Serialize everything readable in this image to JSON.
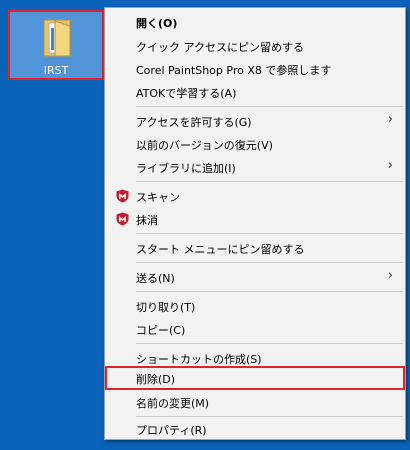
{
  "desktop": {
    "icon_label": "IRST",
    "background_color": "#0a63b8",
    "highlight_color": "#e0242e"
  },
  "menu": {
    "items": [
      {
        "label": "開く(O)",
        "bold": true
      },
      {
        "label": "クイック アクセスにピン留めする"
      },
      {
        "label": "Corel PaintShop Pro X8 で参照します"
      },
      {
        "label": "ATOKで学習する(A)"
      },
      {
        "label": "アクセスを許可する(G)",
        "submenu": true
      },
      {
        "label": "以前のバージョンの復元(V)"
      },
      {
        "label": "ライブラリに追加(I)",
        "submenu": true
      },
      {
        "label": "スキャン",
        "icon": "mcafee-shield-icon"
      },
      {
        "label": "抹消",
        "icon": "mcafee-shield-icon"
      },
      {
        "label": "スタート メニューにピン留めする"
      },
      {
        "label": "送る(N)",
        "submenu": true
      },
      {
        "label": "切り取り(T)"
      },
      {
        "label": "コピー(C)"
      },
      {
        "label": "ショートカットの作成(S)"
      },
      {
        "label": "削除(D)",
        "highlighted": true
      },
      {
        "label": "名前の変更(M)"
      },
      {
        "label": "プロパティ(R)"
      }
    ],
    "submenu_arrow": "›"
  }
}
